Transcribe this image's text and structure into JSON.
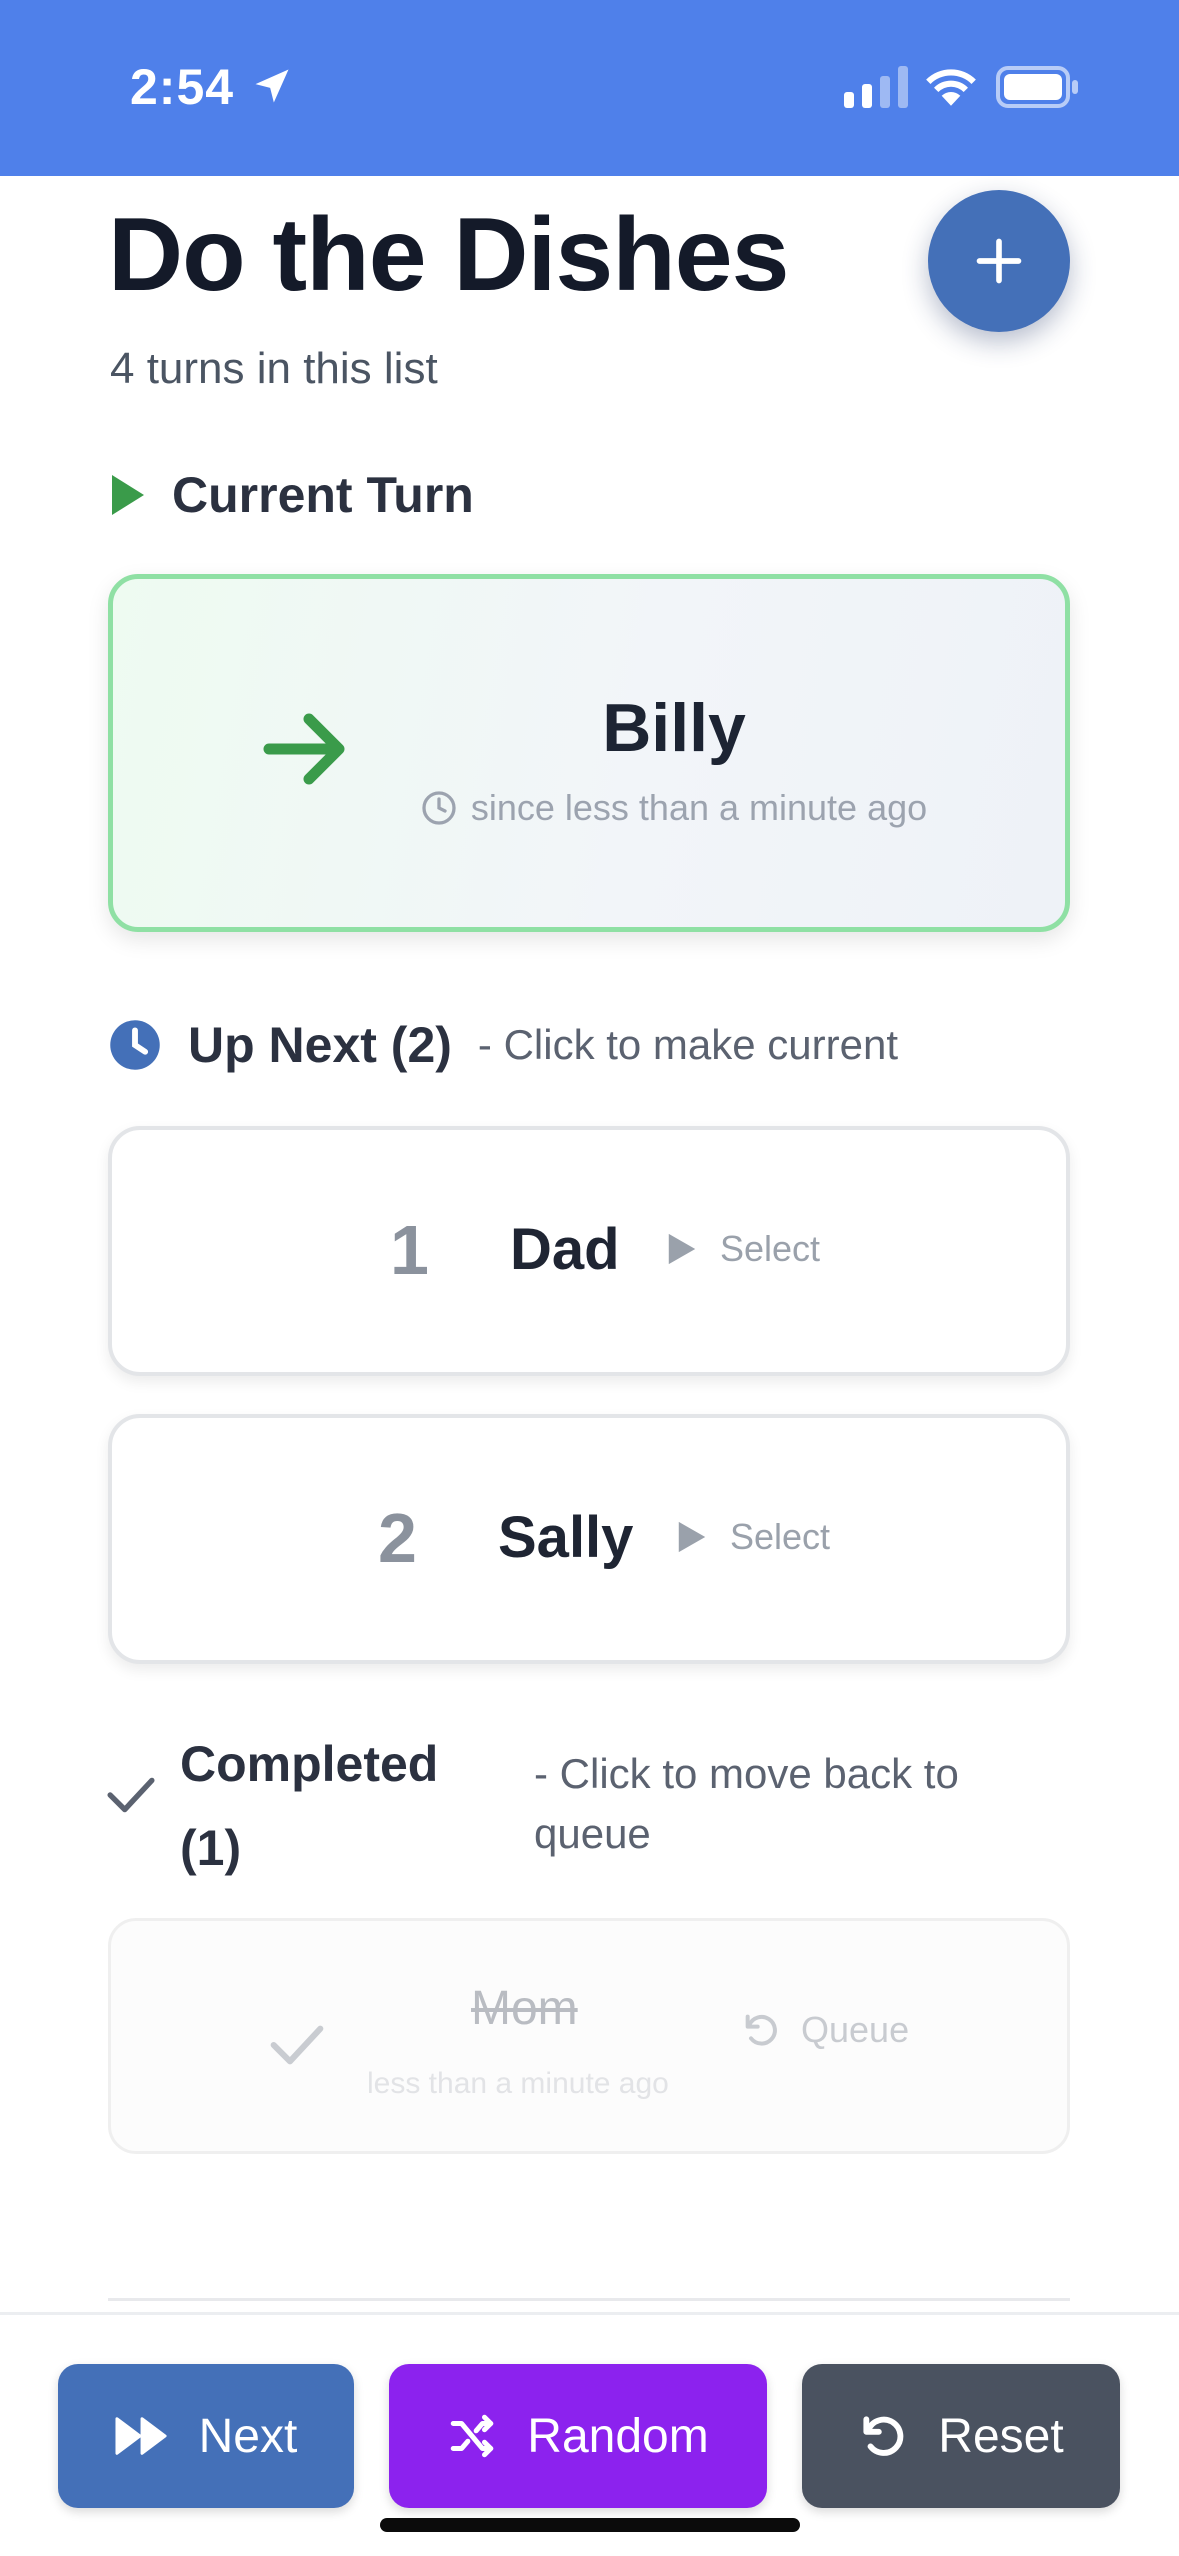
{
  "status_bar": {
    "time": "2:54",
    "icons": [
      "location-arrow-icon",
      "cell-signal-icon",
      "wifi-icon",
      "battery-icon"
    ],
    "background": "#4f80ea"
  },
  "header": {
    "title": "Do the Dishes",
    "subtitle": "4 turns in this list",
    "add_button_icon": "plus-icon"
  },
  "current_turn": {
    "heading": "Current Turn",
    "heading_icon": "play-icon",
    "name": "Billy",
    "since": "since less than a minute ago",
    "arrow_icon": "arrow-right-icon",
    "accent": "#3a9b4a"
  },
  "up_next": {
    "heading": "Up Next (2)",
    "hint": "- Click to make current",
    "heading_icon": "clock-icon",
    "items": [
      {
        "number": "1",
        "name": "Dad",
        "action": "Select"
      },
      {
        "number": "2",
        "name": "Sally",
        "action": "Select"
      }
    ]
  },
  "completed": {
    "heading_line1": "Completed",
    "heading_line2": "(1)",
    "hint_line1": "- Click to move back to",
    "hint_line2": "queue",
    "heading_icon": "check-icon",
    "items": [
      {
        "name": "Mom",
        "time": "less than a minute ago",
        "action": "Queue"
      }
    ]
  },
  "actions": {
    "next_label": "Next",
    "random_label": "Random",
    "reset_label": "Reset",
    "colors": {
      "next": "#4470b8",
      "random": "#8c22ee",
      "reset": "#4a5260"
    }
  }
}
